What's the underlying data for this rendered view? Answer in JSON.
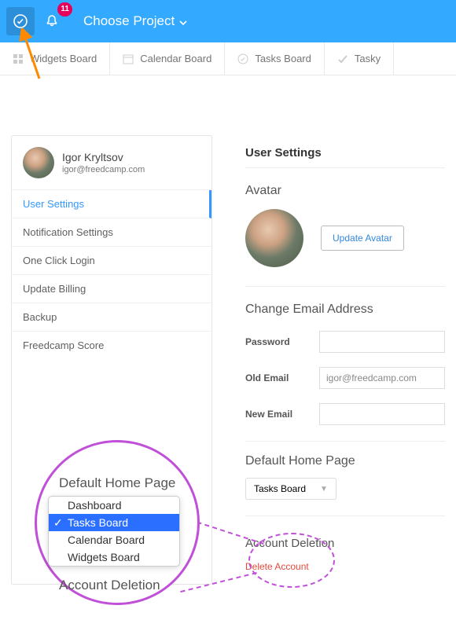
{
  "topbar": {
    "notification_count": "11",
    "choose_label": "Choose Project"
  },
  "tabs": [
    {
      "label": "Widgets Board"
    },
    {
      "label": "Calendar Board"
    },
    {
      "label": "Tasks Board"
    },
    {
      "label": "Tasky"
    }
  ],
  "user": {
    "name": "Igor Kryltsov",
    "email": "igor@freedcamp.com"
  },
  "sidebar": {
    "items": [
      "User Settings",
      "Notification Settings",
      "One Click Login",
      "Update Billing",
      "Backup",
      "Freedcamp Score"
    ]
  },
  "settings": {
    "title": "User Settings",
    "avatar_section": "Avatar",
    "update_avatar": "Update Avatar",
    "change_email_title": "Change Email Address",
    "password_label": "Password",
    "old_email_label": "Old Email",
    "old_email_value": "igor@freedcamp.com",
    "new_email_label": "New Email",
    "default_home_title": "Default Home Page",
    "default_home_value": "Tasks Board",
    "deletion_title": "Account Deletion",
    "delete_link": "Delete Account"
  },
  "magnifier": {
    "title": "Default Home Page",
    "options": [
      "Dashboard",
      "Tasks Board",
      "Calendar Board",
      "Widgets Board"
    ],
    "deletion_title": "Account Deletion",
    "delete_text": "Account"
  }
}
